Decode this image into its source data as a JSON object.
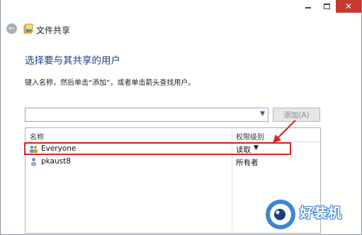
{
  "window": {
    "minimize_icon": "minimize-icon",
    "maximize_icon": "maximize-icon",
    "close_glyph": "✕"
  },
  "nav": {
    "back_glyph": "←",
    "title": "文件共享"
  },
  "main": {
    "heading": "选择要与其共享的用户",
    "instruction": "键入名称，然后单击“添加”，或者单击箭头查找用户。",
    "combo": {
      "value": "",
      "placeholder": ""
    },
    "add_button": "添加(A)"
  },
  "table": {
    "columns": [
      "名称",
      "权限级别"
    ],
    "rows": [
      {
        "name": "Everyone",
        "permission": "读取",
        "has_dropdown": true,
        "icon": "group-users-icon"
      },
      {
        "name": "pkaust8",
        "permission": "所有者",
        "has_dropdown": false,
        "icon": "user-icon"
      }
    ]
  },
  "annotation": {
    "color": "#d9262a"
  },
  "watermark": {
    "text": "好装机",
    "color": "#3b86d4"
  }
}
